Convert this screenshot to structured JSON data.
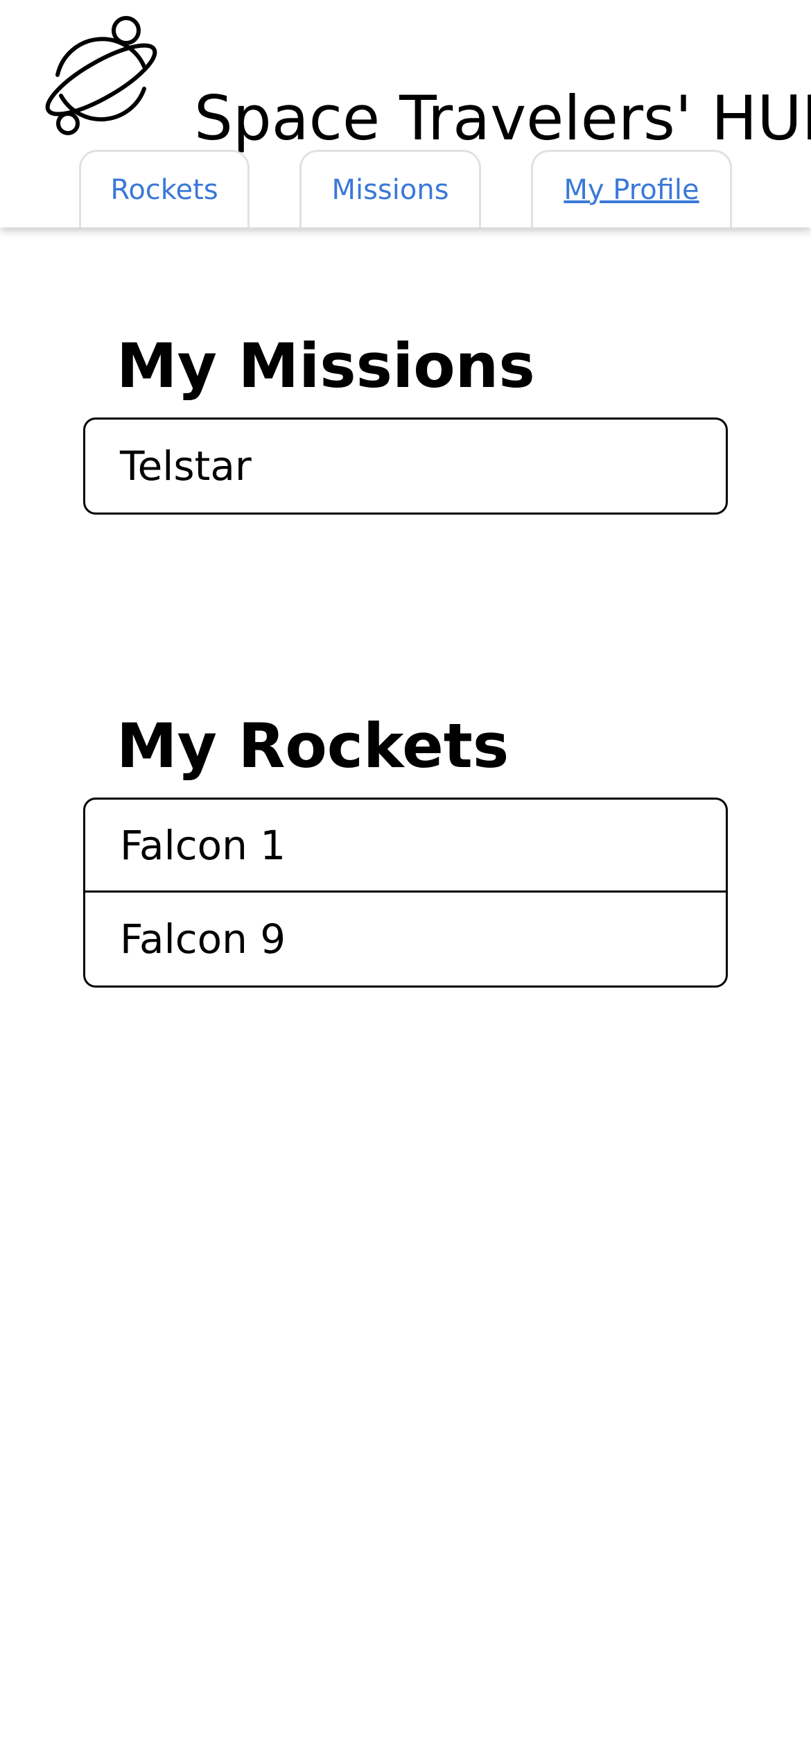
{
  "header": {
    "logo_icon": "planet-icon",
    "title": "Space Travelers' HUB",
    "tabs": [
      {
        "label": "Rockets",
        "active": false
      },
      {
        "label": "Missions",
        "active": false
      },
      {
        "label": "My Profile",
        "active": true
      }
    ],
    "tab_color": "#3a78d8"
  },
  "missions": {
    "heading": "My Missions",
    "items": [
      "Telstar"
    ]
  },
  "rockets": {
    "heading": "My Rockets",
    "items": [
      "Falcon 1",
      "Falcon 9"
    ]
  }
}
